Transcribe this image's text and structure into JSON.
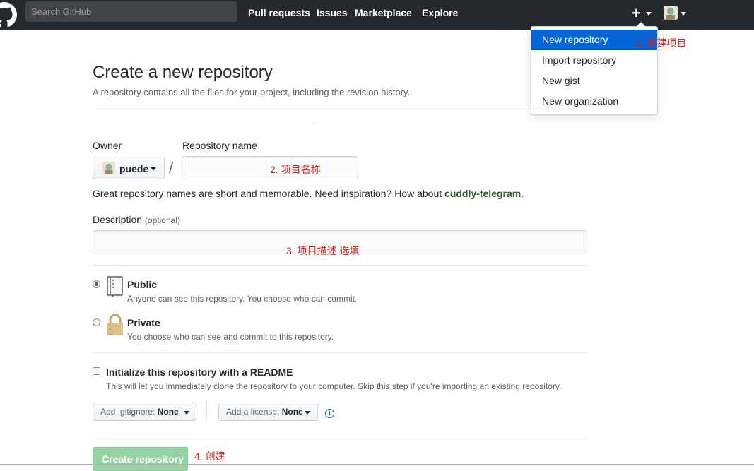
{
  "header": {
    "search_placeholder": "Search GitHub",
    "nav": [
      "Pull requests",
      "Issues",
      "Marketplace",
      "Explore"
    ],
    "plus_label": "+"
  },
  "dropdown": {
    "items": [
      "New repository",
      "Import repository",
      "New gist",
      "New organization"
    ],
    "active_index": 0
  },
  "annotations": {
    "step1": "1. 新建项目",
    "step2": "2. 项目名称",
    "step3": "3. 项目描述   选填",
    "step4": "4. 创建",
    "dot": "·"
  },
  "page": {
    "title": "Create a new repository",
    "subtitle": "A repository contains all the files for your project, including the revision history."
  },
  "form": {
    "owner_label": "Owner",
    "owner_name": "puede",
    "slash": "/",
    "repo_name_label": "Repository name",
    "hint_prefix": "Great repository names are short and memorable. Need inspiration? How about ",
    "hint_suggestion": "cuddly-telegram",
    "hint_suffix": ".",
    "description_label": "Description",
    "description_optional": "(optional)",
    "visibility": {
      "selected": "public",
      "public_title": "Public",
      "public_desc": "Anyone can see this repository. You choose who can commit.",
      "private_title": "Private",
      "private_desc": "You choose who can see and commit to this repository."
    },
    "readme": {
      "checked": false,
      "title": "Initialize this repository with a README",
      "desc": "This will let you immediately clone the repository to your computer. Skip this step if you're importing an existing repository."
    },
    "gitignore_label": "Add .gitignore:",
    "gitignore_value": "None",
    "license_label": "Add a license:",
    "license_value": "None",
    "info_glyph": "i",
    "submit_label": "Create repository"
  },
  "colors": {
    "header_bg": "#24292e",
    "active_item": "#0366d6",
    "annotation": "#e0201b",
    "submit_disabled": "#94d3a2"
  }
}
